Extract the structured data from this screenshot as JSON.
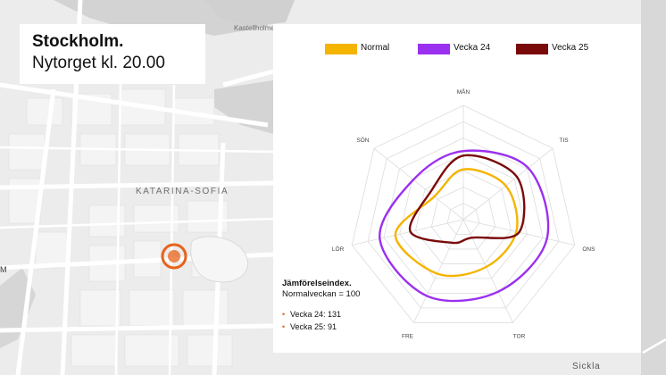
{
  "map": {
    "district_label": "KATARINA-SOFIA",
    "landmark_label": "Kastellholmen",
    "edge_label": "M",
    "corner_label": "Sickla",
    "marker_color": "#e8621a"
  },
  "title_card": {
    "city": "Stockholm.",
    "subtitle": "Nytorget kl. 20.00"
  },
  "note": {
    "heading": "Jämförelseindex.",
    "baseline": "Normalveckan = 100",
    "items": [
      "Vecka 24: 131",
      "Vecka 25: 91"
    ]
  },
  "chart_data": {
    "type": "radar",
    "axes": [
      "MÅN",
      "TIS",
      "ONS",
      "TOR",
      "FRE",
      "LÖR",
      "SÖN"
    ],
    "range": [
      0,
      200
    ],
    "grid": true,
    "legend_position": "top",
    "series": [
      {
        "name": "Normal",
        "color": "#f5b400",
        "values": [
          88,
          95,
          95,
          92,
          105,
          122,
          65
        ]
      },
      {
        "name": "Vecka 24",
        "color": "#9b30f0",
        "values": [
          120,
          145,
          150,
          140,
          148,
          150,
          112
        ]
      },
      {
        "name": "Vecka 25",
        "color": "#7a0a0a",
        "values": [
          112,
          120,
          100,
          35,
          45,
          95,
          75
        ]
      }
    ]
  }
}
